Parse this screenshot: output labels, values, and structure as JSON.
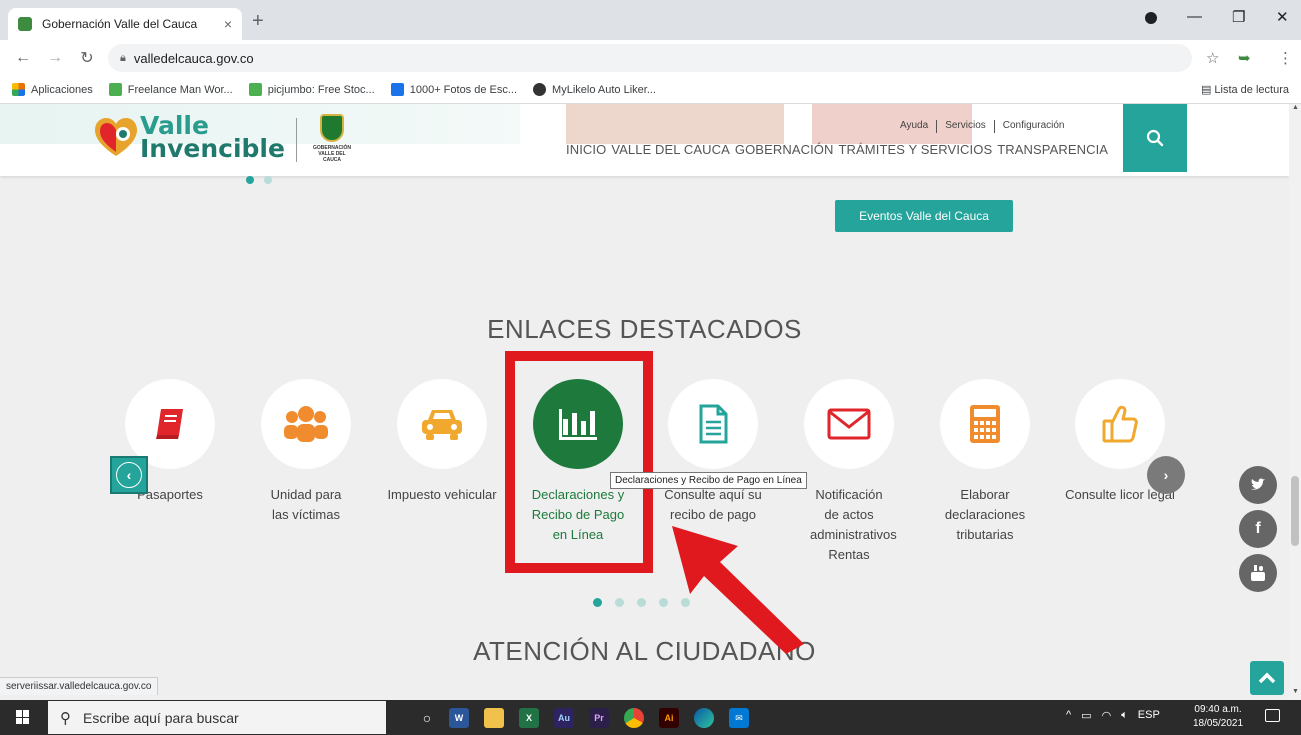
{
  "browser": {
    "tab_title": "Gobernación Valle del Cauca",
    "tab_close": "×",
    "new_tab": "+",
    "url": "valledelcauca.gov.co",
    "bookmarks": [
      {
        "label": "Aplicaciones",
        "color": "#e8710a"
      },
      {
        "label": "Freelance Man Wor...",
        "color": "#4caf50"
      },
      {
        "label": "picjumbo: Free Stoc...",
        "color": "#4caf50"
      },
      {
        "label": "1000+ Fotos de Esc...",
        "color": "#1a73e8"
      },
      {
        "label": "MyLikelo Auto Liker...",
        "color": "#333333"
      }
    ],
    "reading_list": "Lista de lectura"
  },
  "site": {
    "logo_line1": "Valle",
    "logo_line2": "Invencible",
    "gob_label": "GOBERNACIÓN VALLE DEL CAUCA",
    "top_links": [
      "Ayuda",
      "Servicios",
      "Configuración"
    ],
    "nav": [
      "INICIO",
      "VALLE DEL CAUCA",
      "GOBERNACIÓN",
      "TRÁMITES Y SERVICIOS",
      "TRANSPARENCIA"
    ],
    "events_button": "Eventos Valle del Cauca",
    "featured_title": "ENLACES DESTACADOS",
    "featured_links": [
      {
        "label": "Pasaportes",
        "icon": "book-icon",
        "color": "#e0252b"
      },
      {
        "label": "Unidad para las víctimas",
        "icon": "users-icon",
        "color": "#f08c2e"
      },
      {
        "label": "Impuesto vehicular",
        "icon": "car-icon",
        "color": "#f0a92e"
      },
      {
        "label": "Declaraciones y Recibo de Pago en Línea",
        "icon": "chart-icon",
        "color": "#1d7a3c"
      },
      {
        "label": "Consulte aquí su recibo de pago",
        "icon": "document-icon",
        "color": "#24a49a"
      },
      {
        "label": "Notificación de actos administrativos Rentas",
        "icon": "envelope-icon",
        "color": "#e0252b"
      },
      {
        "label": "Elaborar declaraciones tributarias",
        "icon": "calculator-icon",
        "color": "#f08c2e"
      },
      {
        "label": "Consulte licor legal",
        "icon": "thumbs-up-icon",
        "color": "#f0a92e"
      }
    ],
    "tooltip": "Declaraciones y Recibo de Pago en Línea",
    "citizen_title": "ATENCIÓN AL CIUDADANO",
    "status_url": "serveriissar.valledelcauca.gov.co"
  },
  "taskbar": {
    "search_placeholder": "Escribe aquí para buscar",
    "language": "ESP",
    "time": "09:40 a.m.",
    "date": "18/05/2021"
  },
  "colors": {
    "accent": "#24a49a",
    "highlight": "#e0191f",
    "active_icon": "#1d7a3c"
  }
}
